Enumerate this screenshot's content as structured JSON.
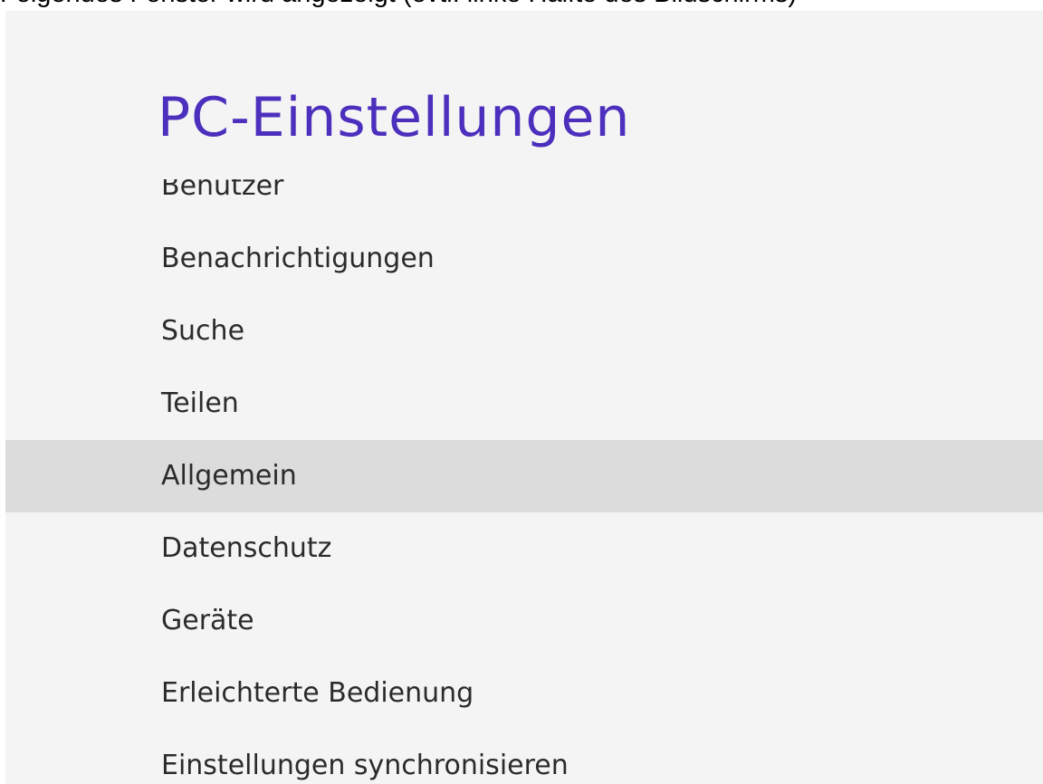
{
  "caption": "Folgendes Fenster wird angezeigt (evtl. linke Hälfte des Bildschirms)",
  "settings": {
    "title": "PC-Einstellungen",
    "selected_index": 4,
    "items": [
      {
        "label": "Benutzer"
      },
      {
        "label": "Benachrichtigungen"
      },
      {
        "label": "Suche"
      },
      {
        "label": "Teilen"
      },
      {
        "label": "Allgemein"
      },
      {
        "label": "Datenschutz"
      },
      {
        "label": "Geräte"
      },
      {
        "label": "Erleichterte Bedienung"
      },
      {
        "label": "Einstellungen synchronisieren"
      }
    ]
  },
  "colors": {
    "title": "#4c2fbd",
    "panel_background": "#f4f4f4",
    "selected_background": "#dcdcdc"
  }
}
